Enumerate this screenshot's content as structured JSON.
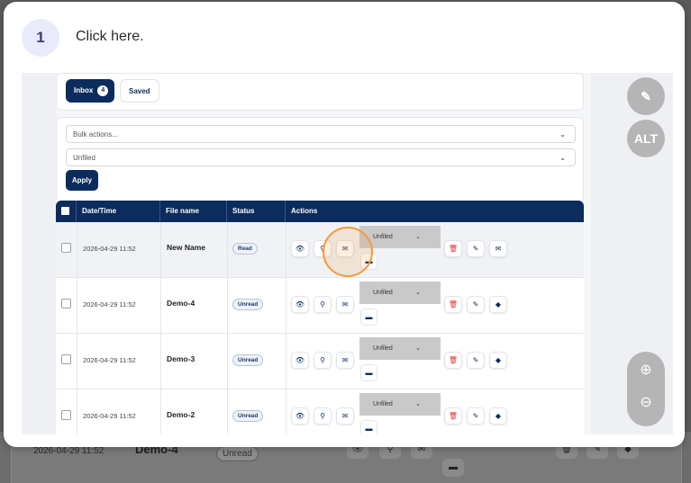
{
  "tutorial": {
    "step_number": "1",
    "instruction": "Click here."
  },
  "tabs": [
    {
      "label": "Inbox",
      "count": "4"
    },
    {
      "label": "Saved"
    }
  ],
  "filters": {
    "bulk_actions": "Bulk actions...",
    "folder": "Unfiled",
    "apply_label": "Apply"
  },
  "table": {
    "headers": [
      "Date/Time",
      "File name",
      "Status",
      "Actions"
    ],
    "rows": [
      {
        "date": "2026-04-29 11:52",
        "name": "New Name",
        "status": "Read",
        "folder": "Unfiled"
      },
      {
        "date": "2026-04-29 11:52",
        "name": "Demo-4",
        "status": "Unread",
        "folder": "Unfiled"
      },
      {
        "date": "2026-04-29 11:52",
        "name": "Demo-3",
        "status": "Unread",
        "folder": "Unfiled"
      },
      {
        "date": "2026-04-29 11:52",
        "name": "Demo-2",
        "status": "Unread",
        "folder": "Unfiled"
      }
    ]
  },
  "background": {
    "date": "2026-04-29 11:52",
    "name": "Demo-4",
    "status": "Unread"
  },
  "side_buttons": {
    "alt_label": "ALT"
  },
  "colors": {
    "primary": "#0b2c5c",
    "highlight": "#f39a3d",
    "delete": "#e0342c"
  },
  "icons": [
    "eye-icon",
    "pin-icon",
    "envelope-icon",
    "trash-icon",
    "pencil-icon",
    "mark-icon",
    "folder-move-icon",
    "pencil-edit-icon",
    "zoom-in-icon",
    "zoom-out-icon"
  ]
}
